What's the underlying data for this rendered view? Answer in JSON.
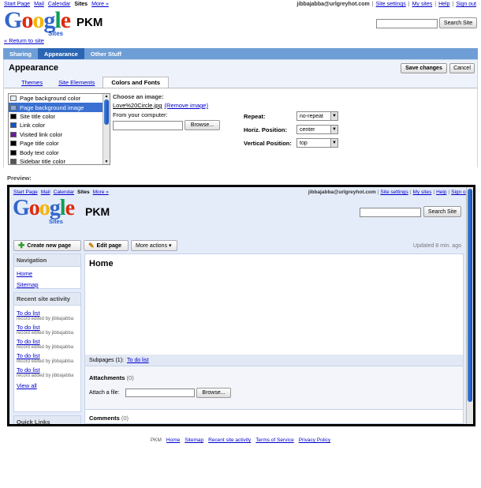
{
  "topnav": {
    "items": [
      "Start Page",
      "Mail",
      "Calendar",
      "Sites",
      "More »"
    ],
    "current": "Sites"
  },
  "account": {
    "email": "jibbajabba@urlgreyhot.com",
    "links": [
      "Site settings",
      "My sites",
      "Help",
      "Sign out"
    ]
  },
  "header": {
    "logo_letters": [
      "G",
      "o",
      "o",
      "g",
      "l",
      "e"
    ],
    "logo_colors": [
      "#3366cc",
      "#dd2b0e",
      "#f4b400",
      "#3366cc",
      "#0f9d58",
      "#dd2b0e"
    ],
    "logo_sub": "Sites",
    "site_title": "PKM",
    "search_button": "Search Site",
    "return_link": "« Return to site"
  },
  "tabs": {
    "items": [
      "Sharing",
      "Appearance",
      "Other Stuff"
    ],
    "active": "Appearance"
  },
  "page": {
    "title": "Appearance",
    "save": "Save changes",
    "cancel": "Cancel"
  },
  "subtabs": {
    "items": [
      "Themes",
      "Site Elements",
      "Colors and Fonts"
    ],
    "active": "Colors and Fonts"
  },
  "element_list": [
    {
      "label": "Page background color",
      "color": "#e9eef7"
    },
    {
      "label": "Page background image",
      "color": "#8aa8d8",
      "selected": true
    },
    {
      "label": "Site title color",
      "color": "#000000"
    },
    {
      "label": "Link color",
      "color": "#1155cc"
    },
    {
      "label": "Visited link color",
      "color": "#6a1b9a"
    },
    {
      "label": "Page title color",
      "color": "#000000"
    },
    {
      "label": "Body text color",
      "color": "#000000"
    },
    {
      "label": "Sidebar title color",
      "color": "#555555"
    }
  ],
  "image_form": {
    "choose": "Choose an image:",
    "file": "Love%20Circle.jpg",
    "remove": "(Remove image)",
    "from": "From your computer:",
    "browse": "Browse..."
  },
  "options": [
    {
      "label": "Repeat:",
      "value": "no-repeat"
    },
    {
      "label": "Horiz. Position:",
      "value": "center"
    },
    {
      "label": "Vertical Position:",
      "value": "top"
    }
  ],
  "preview": {
    "label": "Preview:",
    "topnav": [
      "Start Page",
      "Mail",
      "Calendar",
      "Sites",
      "More »"
    ],
    "account": {
      "email": "jibbajabba@urlgreyhot.com",
      "links": [
        "Site settings",
        "My sites",
        "Help",
        "Sign out"
      ]
    },
    "search_button": "Search Site",
    "site_title": "PKM",
    "create": "Create new page",
    "edit": "Edit page",
    "more": "More actions ▾",
    "updated": "Updated 8 min. ago",
    "nav_title": "Navigation",
    "nav_items": [
      "Home",
      "Sitemap"
    ],
    "activity_title": "Recent site activity",
    "activity": [
      {
        "link": "To do list",
        "note": "record edited by jibbajabba"
      },
      {
        "link": "To do list",
        "note": "record edited by jibbajabba"
      },
      {
        "link": "To do list",
        "note": "record edited by jibbajabba"
      },
      {
        "link": "To do list",
        "note": "record edited by jibbajabba"
      },
      {
        "link": "To do list",
        "note": "record added by jibbajabba"
      }
    ],
    "view_all": "View all",
    "quick_links": "Quick Links",
    "page_title": "Home",
    "subpages_label": "Subpages (1):",
    "subpages_link": "To do list",
    "attachments": "Attachments",
    "attachments_count": "(0)",
    "attach_label": "Attach a file:",
    "browse": "Browse...",
    "comments": "Comments",
    "comments_count": "(0)"
  },
  "footer": {
    "site": "PKM",
    "links": [
      "Home",
      "Sitemap",
      "Recent site activity",
      "Terms of Service",
      "Privacy Policy"
    ]
  }
}
